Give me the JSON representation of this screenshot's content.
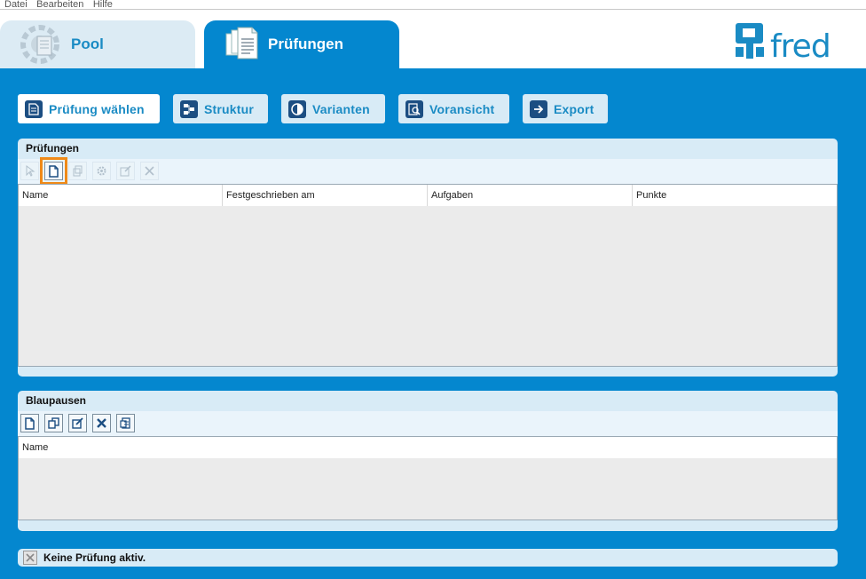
{
  "menubar": {
    "items": [
      "Datei",
      "Bearbeiten",
      "Hilfe"
    ]
  },
  "tabs": [
    {
      "label": "Pool",
      "icon": "pool-icon",
      "active": false
    },
    {
      "label": "Prüfungen",
      "icon": "documents-icon",
      "active": true
    }
  ],
  "logo": {
    "text": "fred"
  },
  "nav": [
    {
      "label": "Prüfung wählen",
      "icon": "document-icon",
      "active": true
    },
    {
      "label": "Struktur",
      "icon": "structure-icon",
      "active": false
    },
    {
      "label": "Varianten",
      "icon": "half-circle-icon",
      "active": false
    },
    {
      "label": "Voransicht",
      "icon": "preview-icon",
      "active": false
    },
    {
      "label": "Export",
      "icon": "arrow-right-icon",
      "active": false
    }
  ],
  "pruefungen": {
    "title": "Prüfungen",
    "columns": [
      "Name",
      "Festgeschrieben am",
      "Aufgaben",
      "Punkte"
    ],
    "rows": []
  },
  "blaupausen": {
    "title": "Blaupausen",
    "columns": [
      "Name"
    ],
    "rows": []
  },
  "status": {
    "text": "Keine Prüfung aktiv."
  },
  "colors": {
    "accent": "#0487cf",
    "panel": "#d8ebf6",
    "highlight": "#f08a18",
    "icon_dark": "#1c4e82"
  }
}
